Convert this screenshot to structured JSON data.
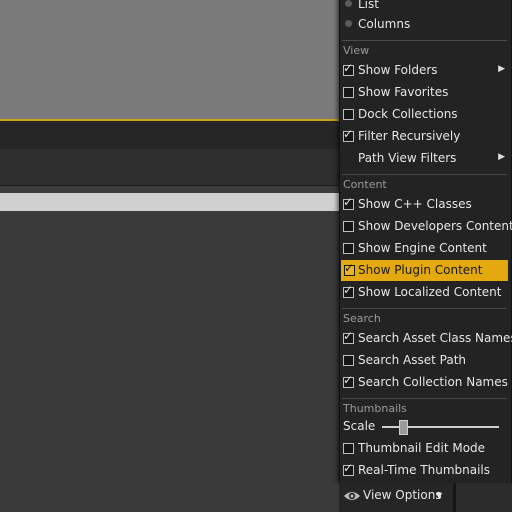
{
  "menu": {
    "list_label": "List",
    "columns_label": "Columns",
    "view_header": "View",
    "show_folders": "Show Folders",
    "show_favorites": "Show Favorites",
    "dock_collections": "Dock Collections",
    "filter_recursively": "Filter Recursively",
    "path_view_filters": "Path View Filters",
    "content_header": "Content",
    "show_cpp_classes": "Show C++ Classes",
    "show_developers_content": "Show Developers Content",
    "show_engine_content": "Show Engine Content",
    "show_plugin_content": "Show Plugin Content",
    "show_localized_content": "Show Localized Content",
    "search_header": "Search",
    "search_asset_class_names": "Search Asset Class Names",
    "search_asset_path": "Search Asset Path",
    "search_collection_names": "Search Collection Names",
    "thumbnails_header": "Thumbnails",
    "scale_label": "Scale",
    "scale_value": 0.18,
    "thumbnail_edit_mode": "Thumbnail Edit Mode",
    "realtime_thumbnails": "Real-Time Thumbnails",
    "checked_states": {
      "show_folders": true,
      "show_favorites": false,
      "dock_collections": false,
      "filter_recursively": true,
      "show_cpp_classes": true,
      "show_developers_content": false,
      "show_engine_content": false,
      "show_plugin_content": true,
      "show_localized_content": true,
      "search_asset_class_names": true,
      "search_asset_path": false,
      "search_collection_names": true,
      "thumbnail_edit_mode": false,
      "realtime_thumbnails": true
    },
    "highlight_color": "#e3a90f"
  },
  "bottom_bar": {
    "view_options_label": "View Options",
    "eye_icon": "eye-icon",
    "caret_icon": "caret-down-icon"
  },
  "colors": {
    "viewport_border": "#c9a11c",
    "menu_bg": "#232323"
  }
}
